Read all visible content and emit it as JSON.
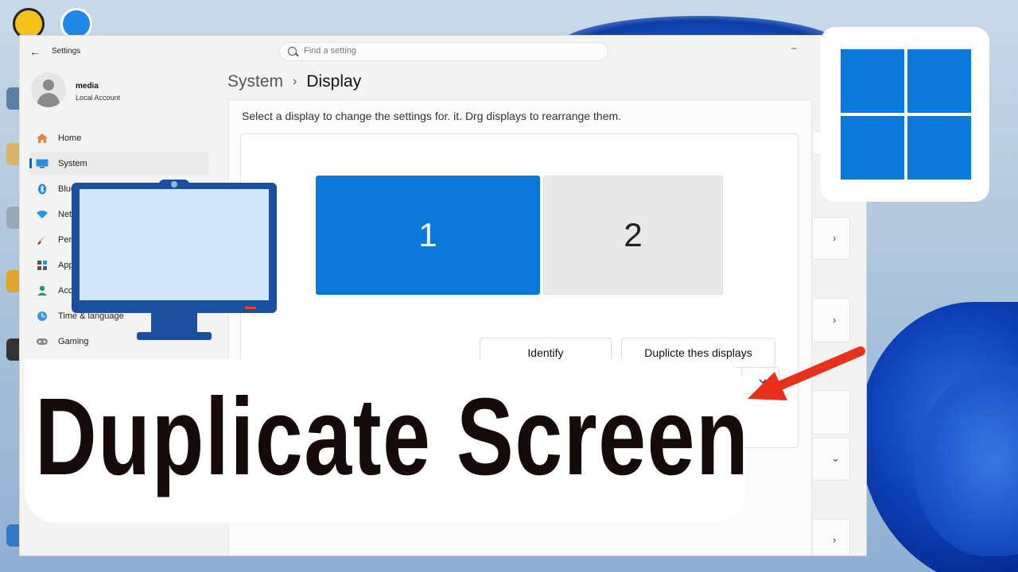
{
  "window": {
    "app_title": "Settings",
    "search_placeholder": "Find a setting"
  },
  "profile": {
    "name": "media",
    "account_type": "Local Account"
  },
  "nav": {
    "items": [
      {
        "label": "Home",
        "icon": "home-icon"
      },
      {
        "label": "System",
        "icon": "system-icon"
      },
      {
        "label": "Blue",
        "icon": "bluetooth-icon"
      },
      {
        "label": "Net",
        "icon": "network-icon"
      },
      {
        "label": "Pers",
        "icon": "personalization-icon"
      },
      {
        "label": "App",
        "icon": "apps-icon"
      },
      {
        "label": "Acc",
        "icon": "accounts-icon"
      },
      {
        "label": "Time & language",
        "icon": "time-language-icon"
      },
      {
        "label": "Gaming",
        "icon": "gaming-icon"
      }
    ]
  },
  "breadcrumb": {
    "parent": "System",
    "separator": "›",
    "current": "Display"
  },
  "display": {
    "instruction": "Select a display to change the settings for. it. Drg displays to rearrange them.",
    "monitor_1": "1",
    "monitor_2": "2",
    "identify_label": "Identify",
    "duplicate_label": "Duplicte thes displays"
  },
  "banner": {
    "text": "Duplicate Screen"
  },
  "colors": {
    "accent": "#0a78d8",
    "arrow": "#e8311a",
    "banner_text": "#160a0a"
  }
}
